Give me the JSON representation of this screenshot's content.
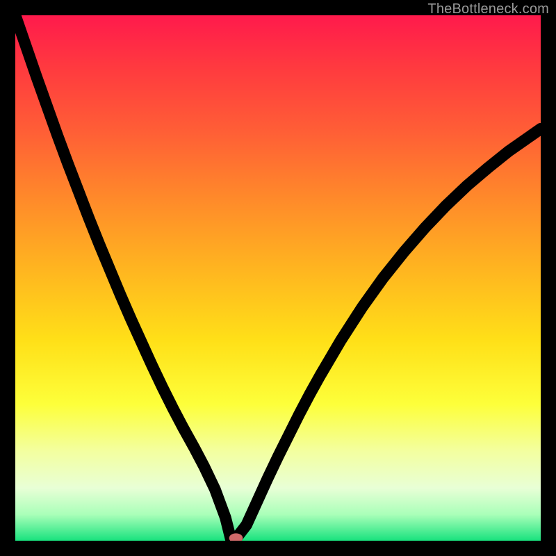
{
  "watermark": "TheBottleneck.com",
  "colors": {
    "frame": "#000000",
    "curve": "#000000",
    "marker": "#cf6a6a",
    "gradient_top": "#ff1a4c",
    "gradient_bottom": "#18e27e",
    "watermark_text": "#9a9a9a"
  },
  "chart_data": {
    "type": "line",
    "title": "",
    "xlabel": "",
    "ylabel": "",
    "xlim": [
      0,
      100
    ],
    "ylim": [
      0,
      100
    ],
    "x": [
      0,
      2,
      4,
      6,
      8,
      10,
      12,
      14,
      16,
      18,
      20,
      22,
      24,
      26,
      28,
      30,
      32,
      34,
      36,
      38,
      40,
      41,
      42,
      44,
      46,
      48,
      50,
      52,
      54,
      56,
      58,
      60,
      62,
      66,
      70,
      74,
      78,
      82,
      86,
      90,
      94,
      98,
      100
    ],
    "y": [
      100,
      94.2,
      88.4,
      82.8,
      77.2,
      71.8,
      66.6,
      61.4,
      56.4,
      51.6,
      46.8,
      42.2,
      37.8,
      33.4,
      29.2,
      25.2,
      21.4,
      17.8,
      14.0,
      9.8,
      4.4,
      0.4,
      0.4,
      3.0,
      7.4,
      11.8,
      16.0,
      20.0,
      24.0,
      27.8,
      31.4,
      34.8,
      38.2,
      44.4,
      50.0,
      55.0,
      59.6,
      63.8,
      67.6,
      71.0,
      74.2,
      77.0,
      78.4
    ],
    "marker": {
      "x": 42,
      "y": 0.5
    },
    "grid": false,
    "legend": false
  }
}
